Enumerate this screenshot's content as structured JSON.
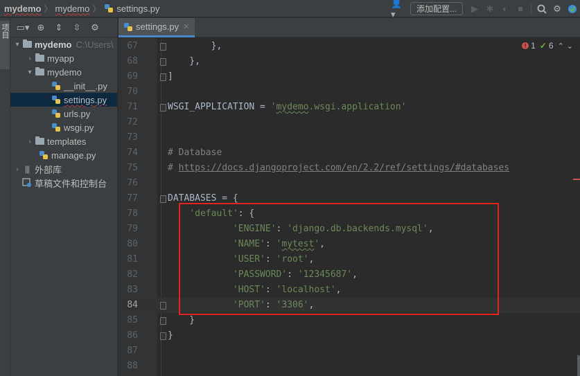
{
  "breadcrumb": {
    "project": "mydemo",
    "folder": "mydemo",
    "file": "settings.py"
  },
  "toolbar": {
    "add_config_label": "添加配置...",
    "icons": [
      "user-icon",
      "run-icon",
      "debug-icon",
      "coverage-icon",
      "stop-icon",
      "search-icon",
      "settings-icon",
      "update-icon"
    ]
  },
  "stripe": {
    "project_tab_label": "项目"
  },
  "project_tree": {
    "root_name": "mydemo",
    "root_path": "C:\\Users\\",
    "items": [
      {
        "label": "myapp",
        "type": "folder",
        "level": 1,
        "expanded": false
      },
      {
        "label": "mydemo",
        "type": "folder",
        "level": 1,
        "expanded": true
      },
      {
        "label": "__init__.py",
        "type": "python",
        "level": 2
      },
      {
        "label": "settings.py",
        "type": "python",
        "level": 2,
        "selected": true
      },
      {
        "label": "urls.py",
        "type": "python",
        "level": 2
      },
      {
        "label": "wsgi.py",
        "type": "python",
        "level": 2
      },
      {
        "label": "templates",
        "type": "folder",
        "level": 1,
        "expanded": false
      },
      {
        "label": "manage.py",
        "type": "python",
        "level": 1
      }
    ],
    "external_libraries": "外部库",
    "scratches": "草稿文件和控制台"
  },
  "editor": {
    "tab_label": "settings.py",
    "inspection": {
      "errors": "1",
      "warnings": "6"
    },
    "current_line": 84,
    "lines": [
      {
        "n": "67",
        "text": "        },"
      },
      {
        "n": "68",
        "text": "    },"
      },
      {
        "n": "69",
        "text": "]"
      },
      {
        "n": "70",
        "text": ""
      },
      {
        "n": "71",
        "text": "WSGI_APPLICATION = 'mydemo.wsgi.application'"
      },
      {
        "n": "72",
        "text": ""
      },
      {
        "n": "73",
        "text": ""
      },
      {
        "n": "74",
        "text": "# Database"
      },
      {
        "n": "75",
        "text": "# https://docs.djangoproject.com/en/2.2/ref/settings/#databases"
      },
      {
        "n": "76",
        "text": ""
      },
      {
        "n": "77",
        "text": "DATABASES = {"
      },
      {
        "n": "78",
        "text": "    'default': {"
      },
      {
        "n": "79",
        "text": "            'ENGINE': 'django.db.backends.mysql',"
      },
      {
        "n": "80",
        "text": "            'NAME': 'mytest',"
      },
      {
        "n": "81",
        "text": "            'USER': 'root',"
      },
      {
        "n": "82",
        "text": "            'PASSWORD': '12345687',"
      },
      {
        "n": "83",
        "text": "            'HOST': 'localhost',"
      },
      {
        "n": "84",
        "text": "            'PORT': '3306',"
      },
      {
        "n": "85",
        "text": "    }"
      },
      {
        "n": "86",
        "text": "}"
      },
      {
        "n": "87",
        "text": ""
      },
      {
        "n": "88",
        "text": ""
      }
    ]
  },
  "colors": {
    "editor_bg": "#2b2b2b",
    "string": "#6a8759",
    "comment": "#808080",
    "identifier": "#a9b7c6",
    "highlight_box": "#e02424"
  }
}
